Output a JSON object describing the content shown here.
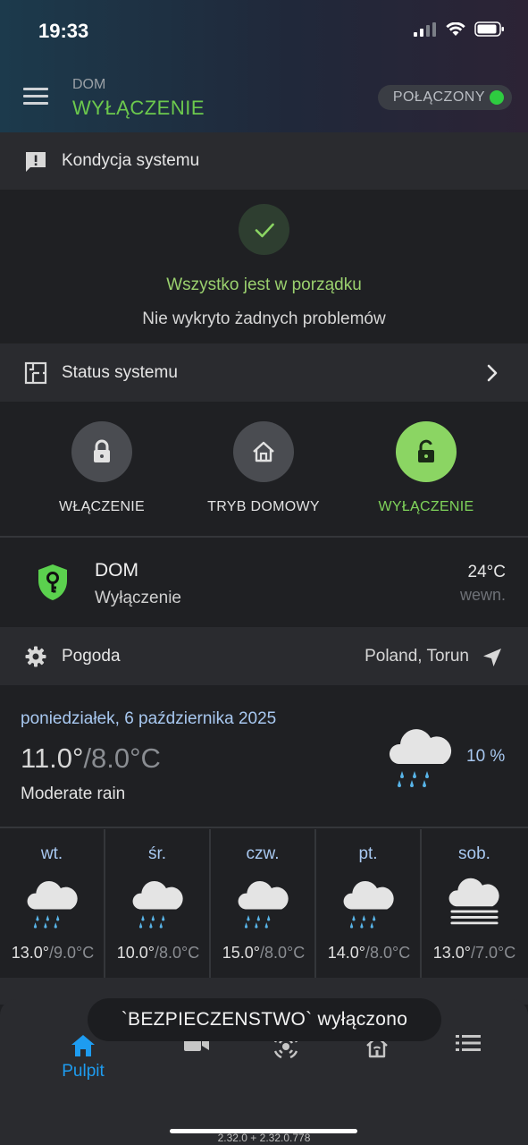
{
  "status_bar": {
    "time": "19:33"
  },
  "header": {
    "breadcrumb": "DOM",
    "title": "WYŁĄCZENIE",
    "connection": "POŁĄCZONY",
    "accent": "#6cc94d",
    "connected_color": "#2ecc40"
  },
  "health": {
    "section_label": "Kondycja systemu",
    "ok": "Wszystko jest w porządku",
    "sub": "Nie wykryto żadnych problemów"
  },
  "system_status": {
    "label": "Status systemu"
  },
  "modes": [
    {
      "label": "WŁĄCZENIE",
      "icon": "lock-icon",
      "active": false
    },
    {
      "label": "TRYB DOMOWY",
      "icon": "home-icon",
      "active": false
    },
    {
      "label": "WYŁĄCZENIE",
      "icon": "unlock-icon",
      "active": true
    }
  ],
  "partition": {
    "name": "DOM",
    "state": "Wyłączenie",
    "temp": "24°C",
    "temp_location": "wewn."
  },
  "weather": {
    "section_label": "Pogoda",
    "location": "Poland, Torun",
    "date": "poniedziałek, 6 października 2025",
    "temp_high": "11.0°",
    "temp_low": "/8.0°C",
    "description": "Moderate rain",
    "precipitation": "10 %",
    "forecast": [
      {
        "day": "wt.",
        "high": "13.0°",
        "low": "/9.0°C",
        "icon": "rain-icon"
      },
      {
        "day": "śr.",
        "high": "10.0°",
        "low": "/8.0°C",
        "icon": "rain-icon"
      },
      {
        "day": "czw.",
        "high": "15.0°",
        "low": "/8.0°C",
        "icon": "rain-icon"
      },
      {
        "day": "pt.",
        "high": "14.0°",
        "low": "/8.0°C",
        "icon": "rain-icon"
      },
      {
        "day": "sob.",
        "high": "13.0°",
        "low": "/7.0°C",
        "icon": "fog-icon"
      }
    ]
  },
  "toast": "`BEZPIECZENSTWO` wyłączono",
  "nav": {
    "dashboard_label": "Pulpit",
    "active_color": "#1e9cf0"
  },
  "version": "2.32.0 + 2.32.0.778"
}
